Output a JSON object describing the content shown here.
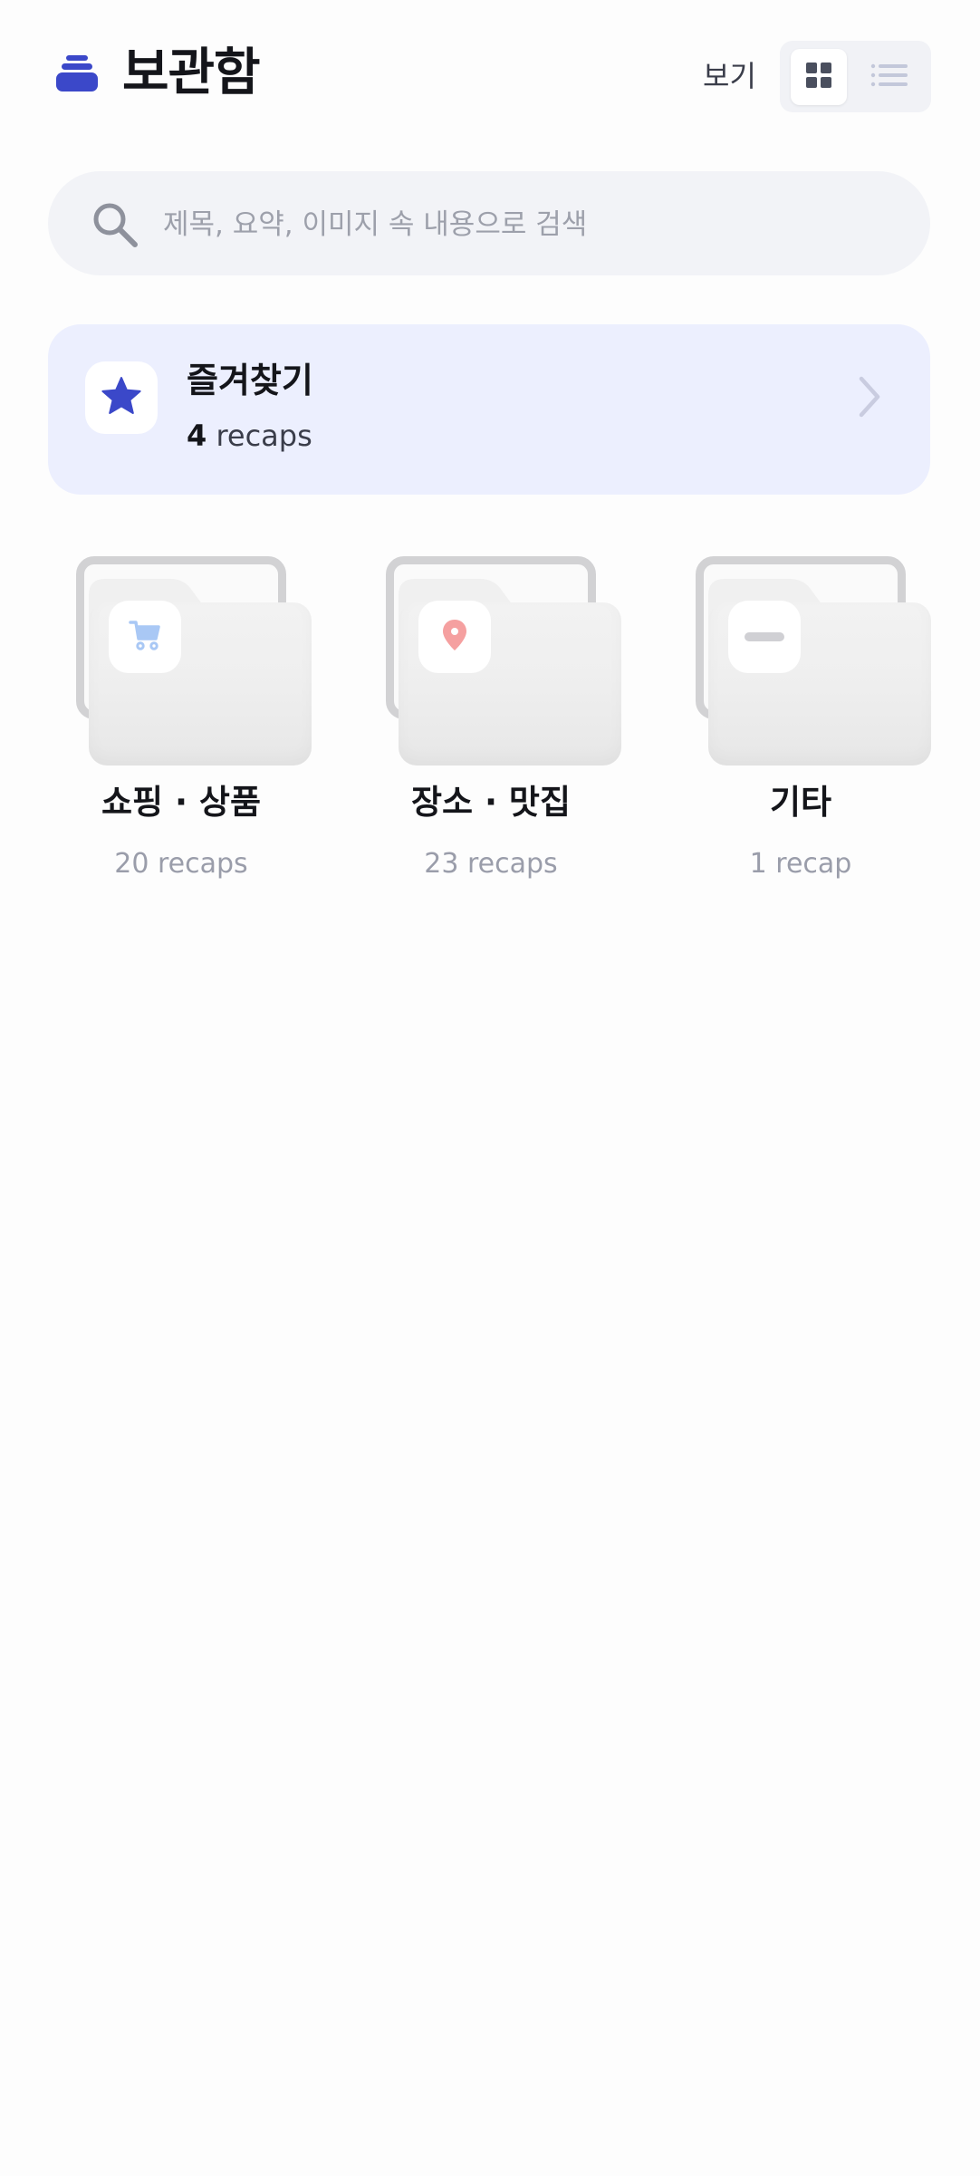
{
  "header": {
    "title": "보관함",
    "app_icon": "stack-icon",
    "view_label": "보기",
    "view_modes": [
      {
        "name": "grid",
        "icon": "grid-icon",
        "selected": true
      },
      {
        "name": "list",
        "icon": "list-icon",
        "selected": false
      }
    ]
  },
  "search": {
    "placeholder": "제목, 요약, 이미지 속 내용으로 검색",
    "value": "",
    "icon": "search-icon"
  },
  "favorites": {
    "title": "즐겨찾기",
    "count": "4",
    "unit": "recaps",
    "icon": "star-icon",
    "chevron": "chevron-right-icon"
  },
  "folders": [
    {
      "name": "쇼핑 · 상품",
      "count": "20 recaps",
      "icon": "cart-icon",
      "icon_color": "#a9c8f5"
    },
    {
      "name": "장소 · 맛집",
      "count": "23 recaps",
      "icon": "location-pin-icon",
      "icon_color": "#f5a0a0"
    },
    {
      "name": "기타",
      "count": "1 recap",
      "icon": "minus-icon",
      "icon_color": "#d0d0d4"
    }
  ],
  "colors": {
    "accent": "#3b48c9",
    "favorites_bg": "#eceffe",
    "search_bg": "#f2f3f7"
  }
}
